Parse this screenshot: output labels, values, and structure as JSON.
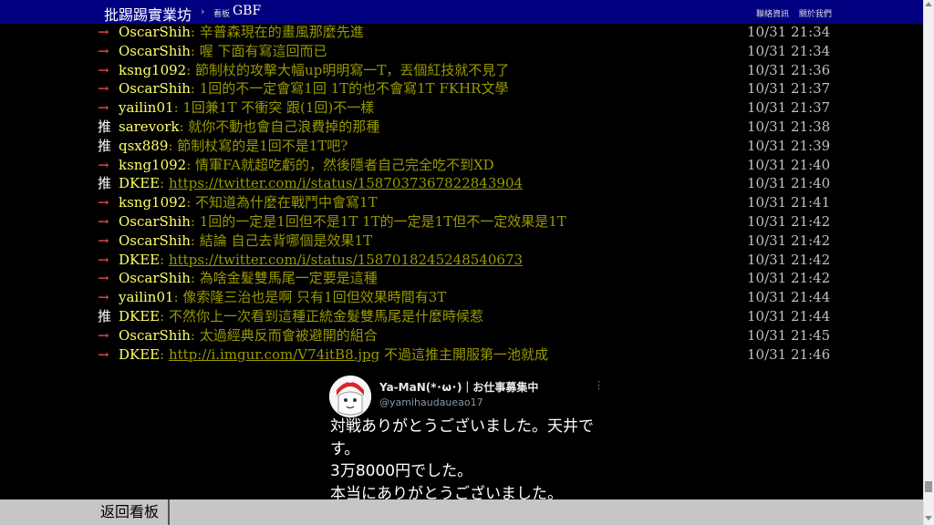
{
  "header": {
    "site_title": "批踢踢實業坊",
    "separator": "›",
    "board_prefix": "看板",
    "board_name": "GBF",
    "links": [
      "聯絡資訊",
      "關於我們"
    ]
  },
  "pushes": [
    {
      "tag": "→",
      "user": "OscarShih",
      "content": ": 辛普森現在的畫風那麼先進",
      "time": "10/31 21:34"
    },
    {
      "tag": "→",
      "user": "OscarShih",
      "content": ": 喔 下面有寫這回而已",
      "time": "10/31 21:34"
    },
    {
      "tag": "→",
      "user": "ksng1092",
      "content": ": 節制杖的攻擊大幅up明明寫一T，丟個紅技就不見了",
      "time": "10/31 21:36"
    },
    {
      "tag": "→",
      "user": "OscarShih",
      "content": ": 1回的不一定會寫1回 1T的也不會寫1T FKHR文學",
      "time": "10/31 21:37"
    },
    {
      "tag": "→",
      "user": "yailin01",
      "content": ": 1回兼1T 不衝突 跟(1回)不一樣",
      "time": "10/31 21:37"
    },
    {
      "tag": "推",
      "user": "sarevork",
      "content": ": 就你不動也會自己浪費掉的那種",
      "time": "10/31 21:38"
    },
    {
      "tag": "推",
      "user": "qsx889",
      "content": ": 節制杖寫的是1回不是1T吧?",
      "time": "10/31 21:39"
    },
    {
      "tag": "→",
      "user": "ksng1092",
      "content": ": 情軍FA就超吃虧的，然後隱者自己完全吃不到XD",
      "time": "10/31 21:40"
    },
    {
      "tag": "推",
      "user": "DKEE",
      "content": ": ",
      "link": "https://twitter.com/i/status/1587037367822843904",
      "time": "10/31 21:40"
    },
    {
      "tag": "→",
      "user": "ksng1092",
      "content": ": 不知道為什麼在戰鬥中會寫1T",
      "time": "10/31 21:41"
    },
    {
      "tag": "→",
      "user": "OscarShih",
      "content": ": 1回的一定是1回但不是1T 1T的一定是1T但不一定效果是1T",
      "time": "10/31 21:42"
    },
    {
      "tag": "→",
      "user": "OscarShih",
      "content": ": 結論 自己去背哪個是效果1T",
      "time": "10/31 21:42"
    },
    {
      "tag": "→",
      "user": "DKEE",
      "content": ": ",
      "link": "https://twitter.com/i/status/1587018245248540673",
      "time": "10/31 21:42"
    },
    {
      "tag": "→",
      "user": "OscarShih",
      "content": ": 為啥金髮雙馬尾一定要是這種",
      "time": "10/31 21:42"
    },
    {
      "tag": "→",
      "user": "yailin01",
      "content": ": 像索隆三治也是啊 只有1回但效果時間有3T",
      "time": "10/31 21:44"
    },
    {
      "tag": "推",
      "user": "DKEE",
      "content": ": 不然你上一次看到這種正統金髮雙馬尾是什麼時候惹",
      "time": "10/31 21:44"
    },
    {
      "tag": "→",
      "user": "OscarShih",
      "content": ": 太過經典反而會被避開的組合",
      "time": "10/31 21:45"
    },
    {
      "tag": "→",
      "user": "DKEE",
      "content": ": ",
      "link": "http://i.imgur.com/V74itB8.jpg",
      "after": " 不過這推主開服第一池就成",
      "time": "10/31 21:46"
    }
  ],
  "tweet": {
    "name": "Ya-MaN(*･ω･)｜お仕事募集中",
    "handle": "@yamihaudaueao17",
    "more": "⋮",
    "lines": [
      "対戦ありがとうございました。天井で",
      "す。",
      "3万8000円でした。",
      "本当にありがとうございました。"
    ]
  },
  "footer": {
    "back_label": "返回看板"
  },
  "colors": {
    "topbar": "#000080",
    "arrow_tag": "#ff5555",
    "push_tag": "#ffffff",
    "user": "#ffff66",
    "content": "#999900",
    "bottombar": "#c6c6c6"
  }
}
